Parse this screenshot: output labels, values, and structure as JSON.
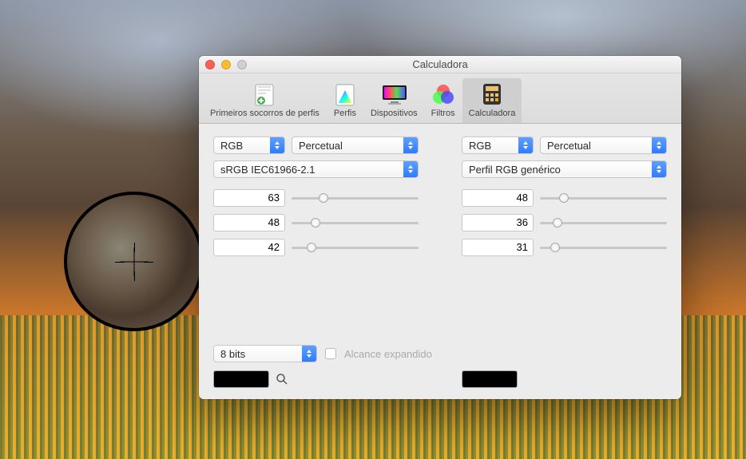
{
  "window": {
    "title": "Calculadora"
  },
  "toolbar": {
    "first_aid": "Primeiros socorros de perfis",
    "profiles": "Perfis",
    "devices": "Dispositivos",
    "filters": "Filtros",
    "calculator": "Calculadora"
  },
  "left": {
    "color_model": "RGB",
    "intent": "Percetual",
    "profile": "sRGB IEC61966-2.1",
    "channels": [
      {
        "value": "63",
        "pct": 25
      },
      {
        "value": "48",
        "pct": 19
      },
      {
        "value": "42",
        "pct": 16
      }
    ]
  },
  "right": {
    "color_model": "RGB",
    "intent": "Percetual",
    "profile": "Perfil RGB genérico",
    "channels": [
      {
        "value": "48",
        "pct": 19
      },
      {
        "value": "36",
        "pct": 14
      },
      {
        "value": "31",
        "pct": 12
      }
    ]
  },
  "options": {
    "bit_depth": "8 bits",
    "extended_range_label": "Alcance expandido"
  },
  "swatches": {
    "left": "#000000",
    "right": "#000000"
  }
}
